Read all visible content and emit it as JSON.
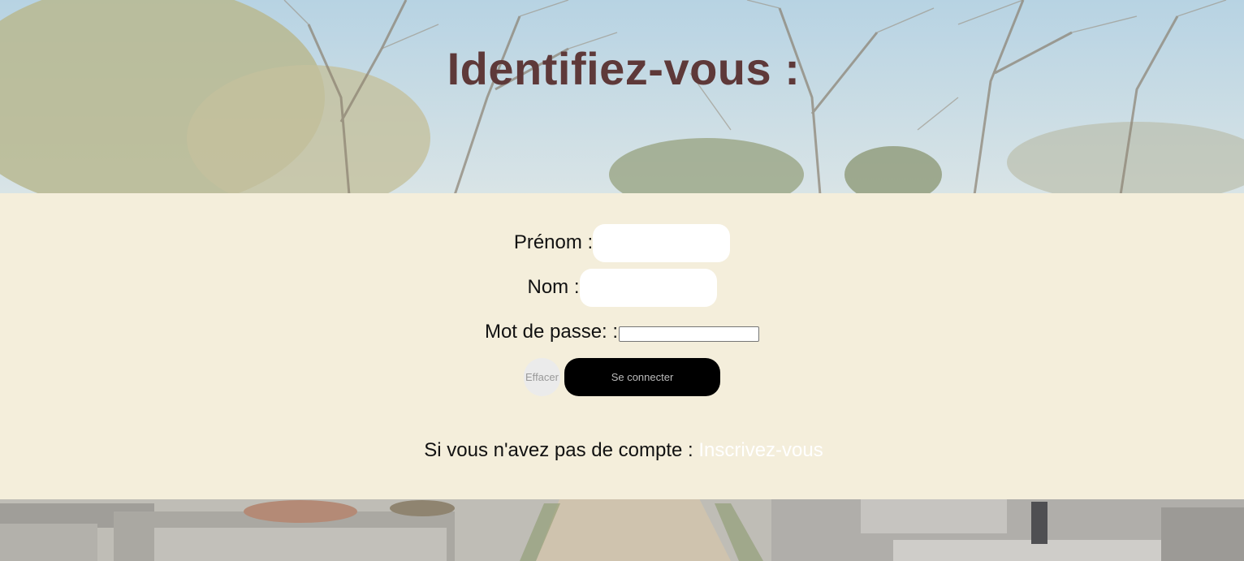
{
  "page": {
    "title": "Identifiez-vous :"
  },
  "form": {
    "first_name_label": "Prénom :",
    "first_name_value": "",
    "last_name_label": "Nom :",
    "last_name_value": "",
    "password_label": "Mot de passe: :",
    "password_value": "",
    "clear_button": "Effacer",
    "submit_button": "Se connecter"
  },
  "signup": {
    "prompt": "Si vous n'avez pas de compte : ",
    "link": "Inscrivez-vous"
  },
  "colors": {
    "title": "#5e3939",
    "panel": "#f4eedb",
    "submit_bg": "#000000",
    "link": "#ffffff"
  }
}
